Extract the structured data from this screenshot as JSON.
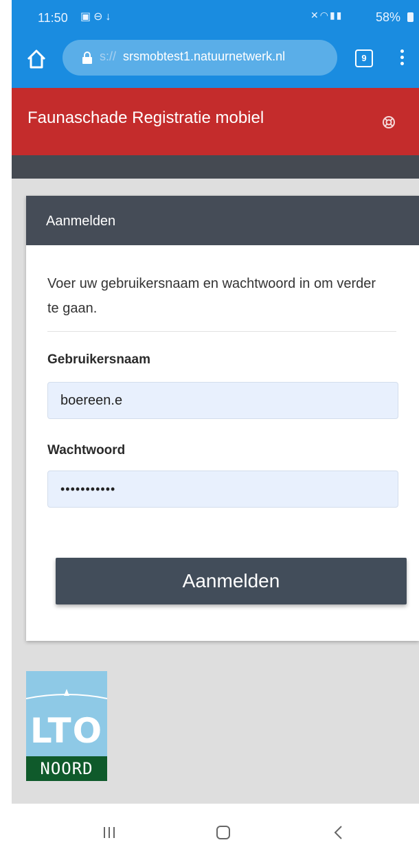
{
  "status_bar": {
    "time": "11:50",
    "battery": "58%",
    "notif_icons": [
      "gallery-icon",
      "dnd-icon",
      "download-icon"
    ],
    "sys_icons": [
      "mute-icon",
      "wifi-icon",
      "signal-icon"
    ]
  },
  "browser": {
    "url_prefix": "s://",
    "url_host": "srsmobtest1.natuurnetwerk.nl",
    "tab_count": "9",
    "accent_color": "#1a8ce0"
  },
  "app": {
    "title": "Faunaschade Registratie mobiel",
    "header_color": "#c42c2c"
  },
  "login": {
    "panel_title": "Aanmelden",
    "intro": "Voer uw gebruikersnaam en wachtwoord in om verder te gaan.",
    "username_label": "Gebruikersnaam",
    "username_value": "boereen.e",
    "password_label": "Wachtwoord",
    "password_value": "•••••••••••",
    "submit_label": "Aanmelden"
  },
  "logo": {
    "main": "LTO",
    "sub": "NOORD"
  }
}
